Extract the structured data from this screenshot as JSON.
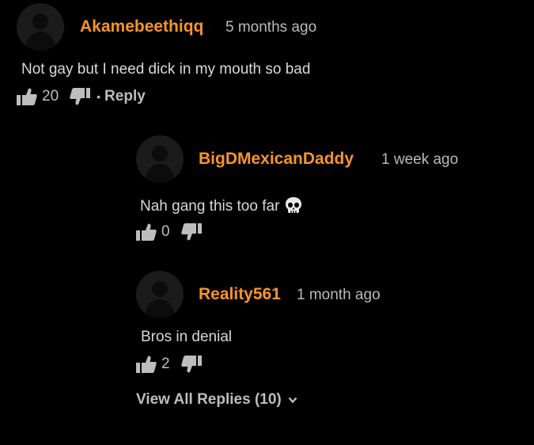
{
  "comments": [
    {
      "username": "Akamebeethiqq",
      "time": "5 months ago",
      "text": "Not gay but I need dick in my mouth so bad",
      "likes": "20",
      "reply_label": "Reply"
    }
  ],
  "replies": [
    {
      "username": "BigDMexicanDaddy",
      "time": "1 week ago",
      "text": "Nah gang this too far",
      "emoji": "skull-icon",
      "likes": "0"
    },
    {
      "username": "Reality561",
      "time": "1 month ago",
      "text": "Bros in denial",
      "likes": "2"
    }
  ],
  "view_all_label": "View All Replies (10)",
  "colors": {
    "background": "#000000",
    "username": "#f7942c",
    "text": "#d8d8d8",
    "meta": "#b9b9b9"
  }
}
